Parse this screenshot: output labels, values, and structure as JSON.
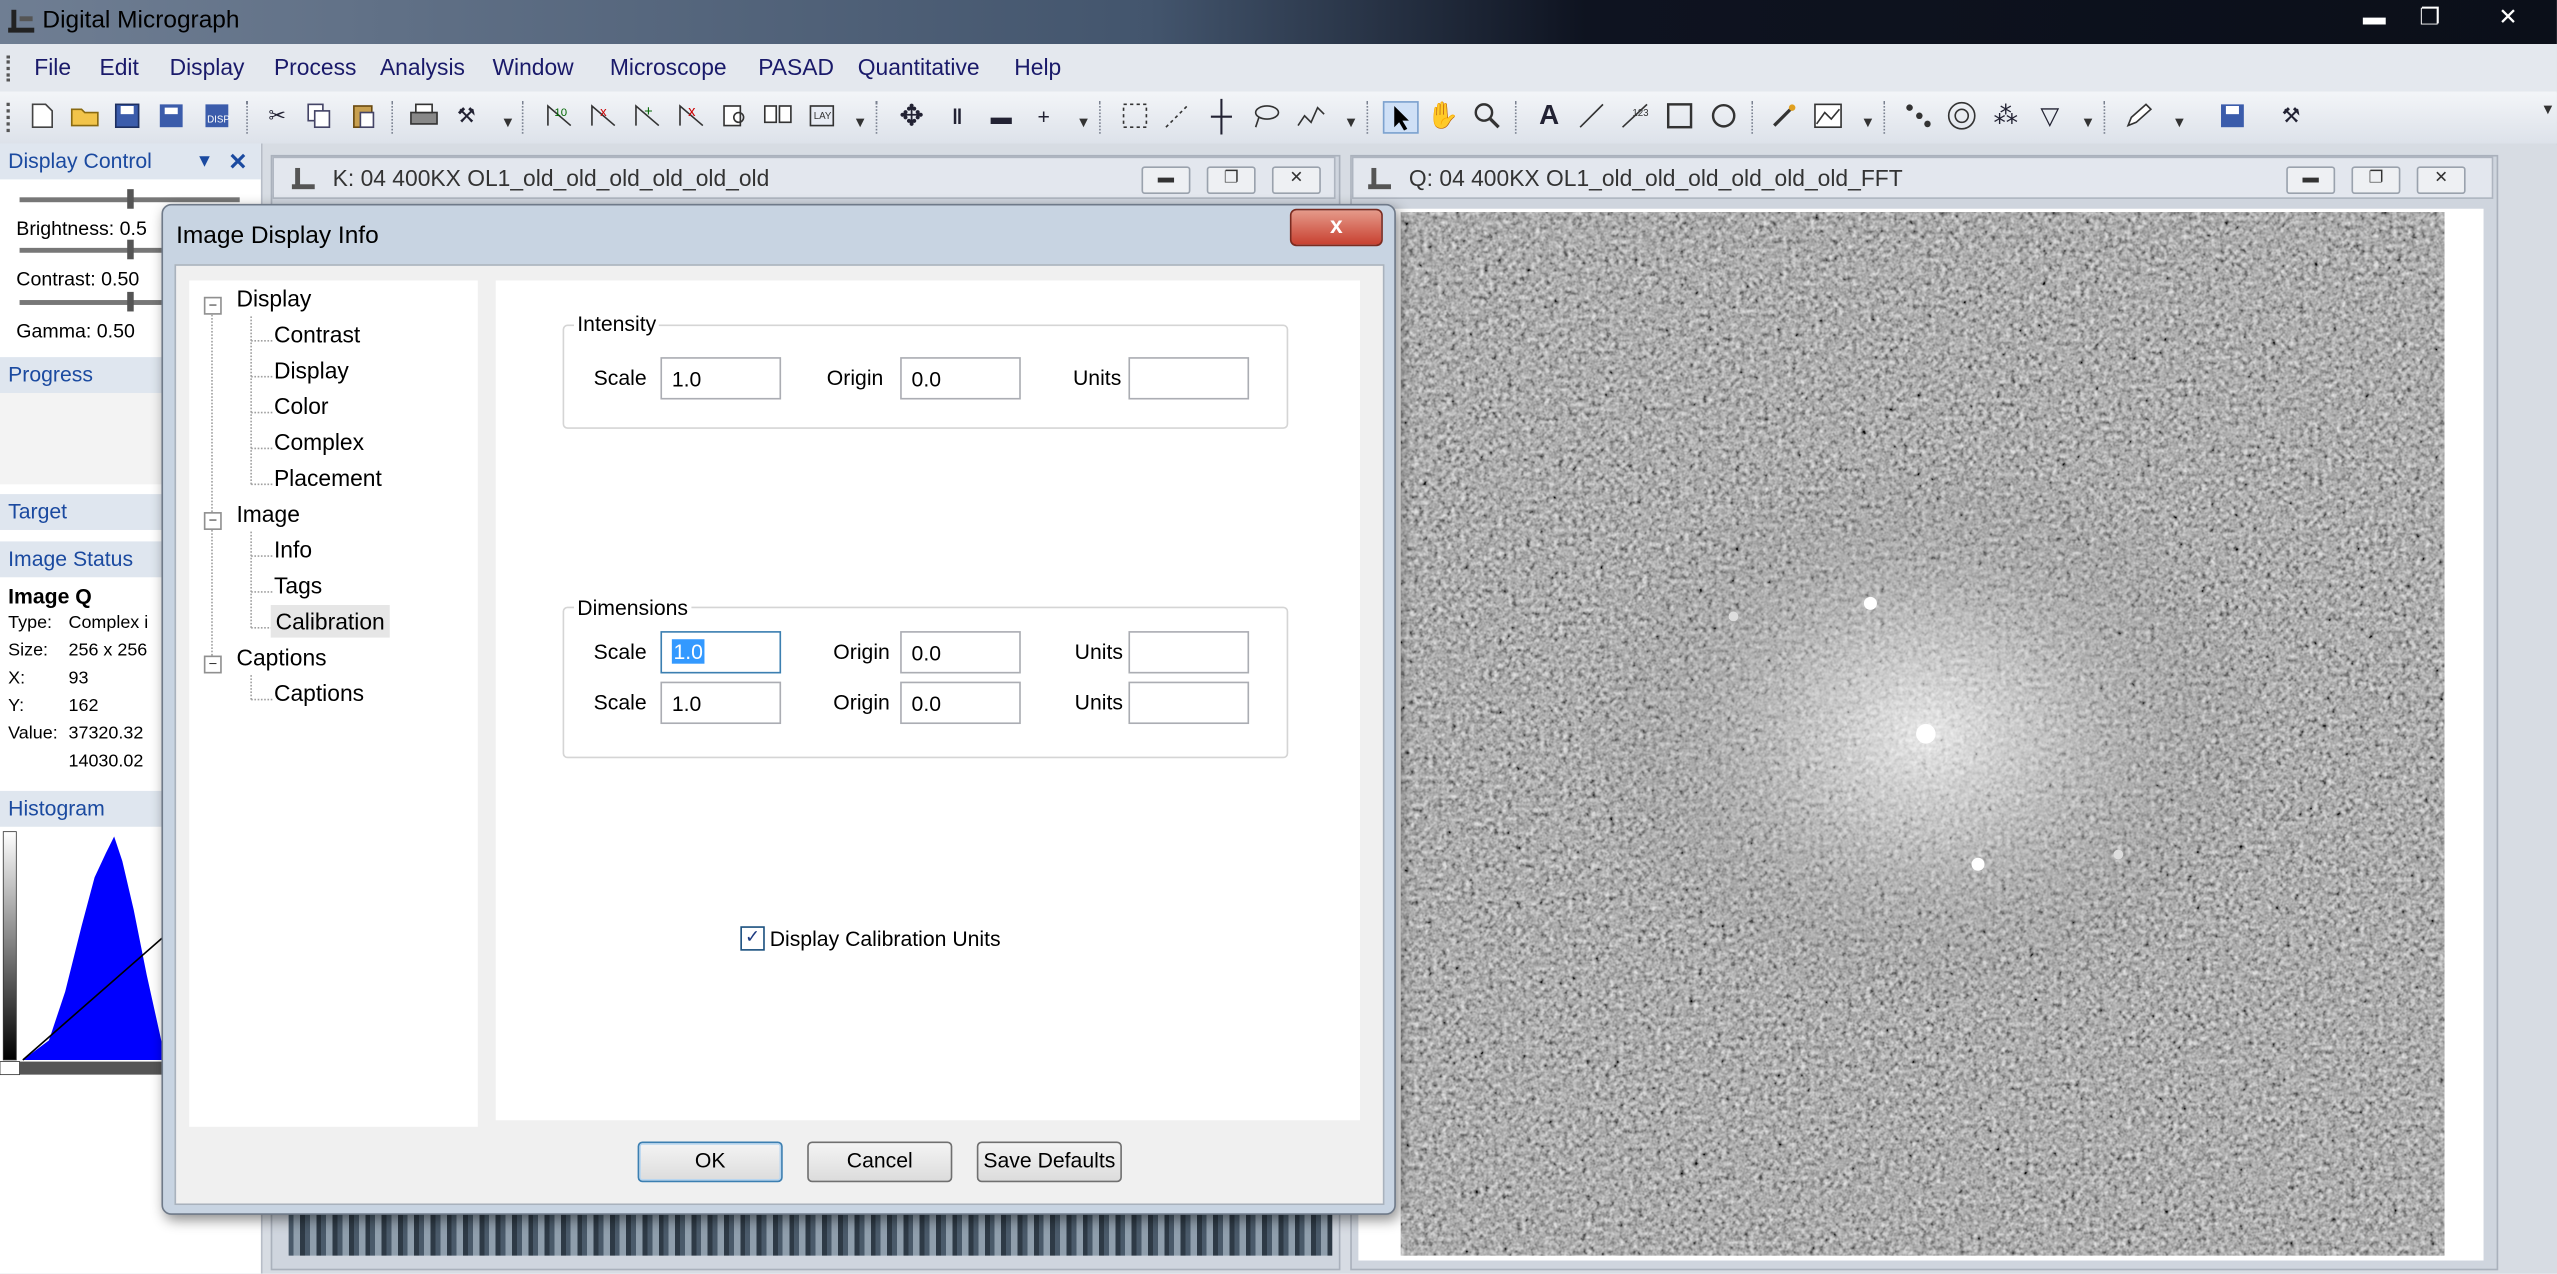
{
  "app": {
    "title": "Digital Micrograph"
  },
  "window_controls": {
    "minimize": "▬",
    "restore": "❐",
    "close": "✕"
  },
  "menu": [
    "File",
    "Edit",
    "Display",
    "Process",
    "Analysis",
    "Window",
    "Microscope",
    "PASAD",
    "Quantitative",
    "Help"
  ],
  "left_panel": {
    "display_control": {
      "title": "Display Control",
      "brightness": "Brightness: 0.5",
      "contrast": "Contrast: 0.50",
      "gamma": "Gamma: 0.50"
    },
    "progress": "Progress",
    "target": "Target",
    "image_status": {
      "title": "Image Status",
      "name": "Image Q",
      "type_label": "Type:",
      "type_value": "Complex i",
      "size_label": "Size:",
      "size_value": "256 x 256",
      "x_label": "X:",
      "x_value": "93",
      "y_label": "Y:",
      "y_value": "162",
      "value_label": "Value:",
      "value_1": "37320.32",
      "value_2": "14030.02"
    },
    "histogram": "Histogram"
  },
  "windows": {
    "left_image": {
      "title": "K: 04 400KX OL1_old_old_old_old_old_old"
    },
    "right_image": {
      "title": "Q: 04 400KX OL1_old_old_old_old_old_old_FFT"
    }
  },
  "dialog": {
    "title": "Image Display Info",
    "close": "x",
    "tree": {
      "display": "Display",
      "display_children": [
        "Contrast",
        "Display",
        "Color",
        "Complex",
        "Placement"
      ],
      "image": "Image",
      "image_children": [
        "Info",
        "Tags",
        "Calibration"
      ],
      "captions": "Captions",
      "captions_children": [
        "Captions"
      ]
    },
    "intensity": {
      "label": "Intensity",
      "scale_label": "Scale",
      "scale": "1.0",
      "origin_label": "Origin",
      "origin": "0.0",
      "units_label": "Units",
      "units": ""
    },
    "dimensions": {
      "label": "Dimensions",
      "rows": [
        {
          "scale_label": "Scale",
          "scale": "1.0",
          "origin_label": "Origin",
          "origin": "0.0",
          "units_label": "Units",
          "units": ""
        },
        {
          "scale_label": "Scale",
          "scale": "1.0",
          "origin_label": "Origin",
          "origin": "0.0",
          "units_label": "Units",
          "units": ""
        }
      ]
    },
    "checkbox": {
      "label": "Display Calibration Units",
      "checked": true
    },
    "buttons": {
      "ok": "OK",
      "cancel": "Cancel",
      "save_defaults": "Save Defaults"
    }
  },
  "colors": {
    "histogram_fill": "#0000ff",
    "accent_header": "#1b4aa0",
    "close_button": "#c84030"
  },
  "icons": [
    "new-icon",
    "open-icon",
    "save-icon",
    "cut-icon",
    "copy-icon",
    "paste-icon",
    "print-icon",
    "tools-icon",
    "select-arrow-icon",
    "hand-icon",
    "zoom-icon",
    "text-icon",
    "line-icon",
    "rect-icon",
    "oval-icon"
  ]
}
